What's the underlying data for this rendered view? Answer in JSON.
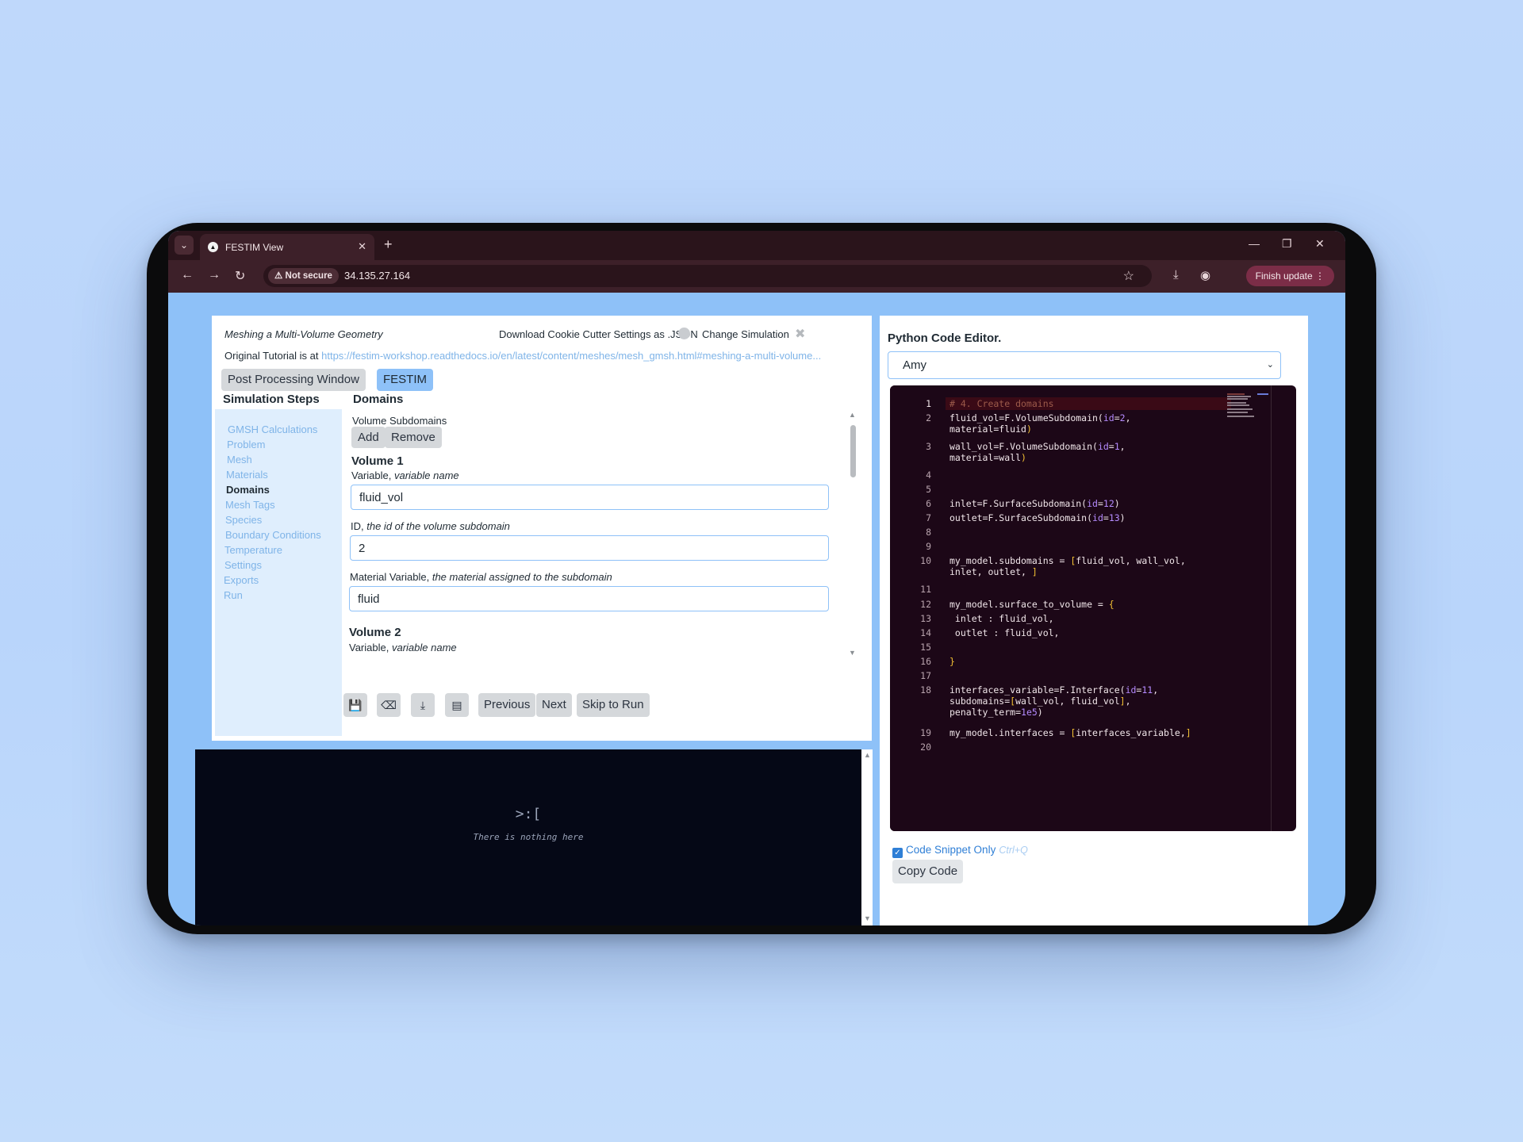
{
  "browser": {
    "tab_title": "FESTIM View",
    "not_secure": "Not secure",
    "url": "34.135.27.164",
    "finish_update": "Finish update"
  },
  "header": {
    "title": "Meshing a Multi-Volume Geometry",
    "download_link": "Download Cookie Cutter Settings as .JSON",
    "change_simulation": "Change Simulation",
    "tutorial_prefix": "Original Tutorial is at",
    "tutorial_url": "https://festim-workshop.readthedocs.io/en/latest/content/meshes/mesh_gmsh.html#meshing-a-multi-volume..."
  },
  "mode_buttons": {
    "post_processing": "Post Processing Window",
    "festim": "FESTIM"
  },
  "steps": {
    "title": "Simulation Steps",
    "items": [
      {
        "label": "GMSH Calculations"
      },
      {
        "label": "Problem"
      },
      {
        "label": "Mesh"
      },
      {
        "label": "Materials"
      },
      {
        "label": "Domains"
      },
      {
        "label": "Mesh Tags"
      },
      {
        "label": "Species"
      },
      {
        "label": "Boundary Conditions"
      },
      {
        "label": "Temperature"
      },
      {
        "label": "Settings"
      },
      {
        "label": "Exports"
      },
      {
        "label": "Run"
      }
    ]
  },
  "domains": {
    "title": "Domains",
    "volume_subdomains": "Volume Subdomains",
    "add": "Add",
    "remove": "Remove",
    "volume1": {
      "heading": "Volume 1",
      "var_label": "Variable,",
      "var_hint": "variable name",
      "var_value": "fluid_vol",
      "id_label": "ID,",
      "id_hint": "the id of the volume subdomain",
      "id_value": "2",
      "mat_label": "Material Variable,",
      "mat_hint": "the material assigned to the subdomain",
      "mat_value": "fluid"
    },
    "volume2": {
      "heading": "Volume 2",
      "var_label": "Variable,",
      "var_hint": "variable name"
    }
  },
  "bottom_nav": {
    "previous": "Previous",
    "next": "Next",
    "skip": "Skip to Run"
  },
  "terminal": {
    "face": ">:[",
    "message": "There is nothing here"
  },
  "editor": {
    "title": "Python Code Editor.",
    "selected_option": "Amy",
    "line_numbers": [
      "1",
      "2",
      "3",
      "4",
      "5",
      "6",
      "7",
      "8",
      "9",
      "10",
      "11",
      "12",
      "13",
      "14",
      "15",
      "16",
      "17",
      "18",
      "19",
      "20"
    ],
    "snippet_label": "Code Snippet Only",
    "snippet_shortcut": "Ctrl+Q",
    "copy_button": "Copy Code"
  },
  "colors": {
    "accent": "#8ec1f8",
    "link": "#7fb4e8",
    "editor_bg": "#1c0717",
    "terminal_bg": "#050816"
  }
}
